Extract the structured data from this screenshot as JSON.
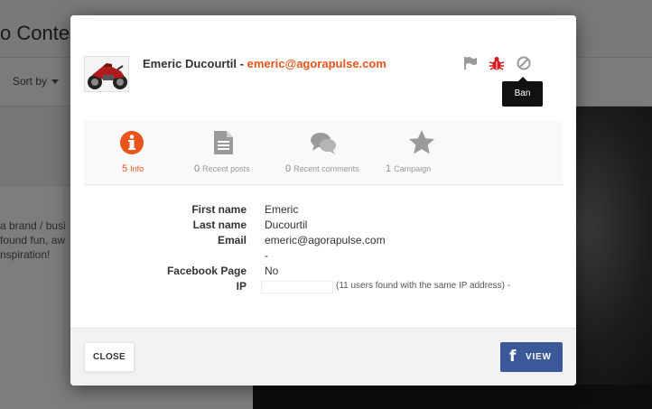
{
  "background": {
    "title_fragment": "o Contest",
    "sort_label": "Sort by",
    "text_lines": [
      "a brand / busi",
      "found fun, aw",
      "nspiration!"
    ]
  },
  "modal": {
    "user": {
      "name": "Emeric Ducourtil",
      "separator": " - ",
      "email": "emeric@agorapulse.com"
    },
    "header_icons": [
      "flag-icon",
      "bug-icon",
      "ban-icon"
    ],
    "tooltip": "Ban",
    "tabs": [
      {
        "count": "5",
        "label": "Info",
        "icon": "info-icon",
        "active": true
      },
      {
        "count": "0",
        "label": "Recent posts",
        "icon": "document-icon",
        "active": false
      },
      {
        "count": "0",
        "label": "Recent comments",
        "icon": "comments-icon",
        "active": false
      },
      {
        "count": "1",
        "label": "Campaign",
        "icon": "star-icon",
        "active": false
      }
    ],
    "details": [
      {
        "label": "First name",
        "value": "Emeric"
      },
      {
        "label": "Last name",
        "value": "Ducourtil"
      },
      {
        "label": "Email",
        "value": "emeric@agorapulse.com"
      },
      {
        "label": "",
        "value": "-"
      },
      {
        "label": "Facebook Page",
        "value": "No"
      },
      {
        "label": "IP",
        "value": "",
        "note": "(11 users found with the same IP address) -"
      }
    ],
    "footer": {
      "close_label": "CLOSE",
      "view_label": "VIEW",
      "view_icon": "facebook-icon"
    }
  },
  "colors": {
    "accent": "#e8551c",
    "bug_red": "#d9191c",
    "facebook_blue": "#3b5998",
    "icon_gray": "#9a9a9a"
  }
}
